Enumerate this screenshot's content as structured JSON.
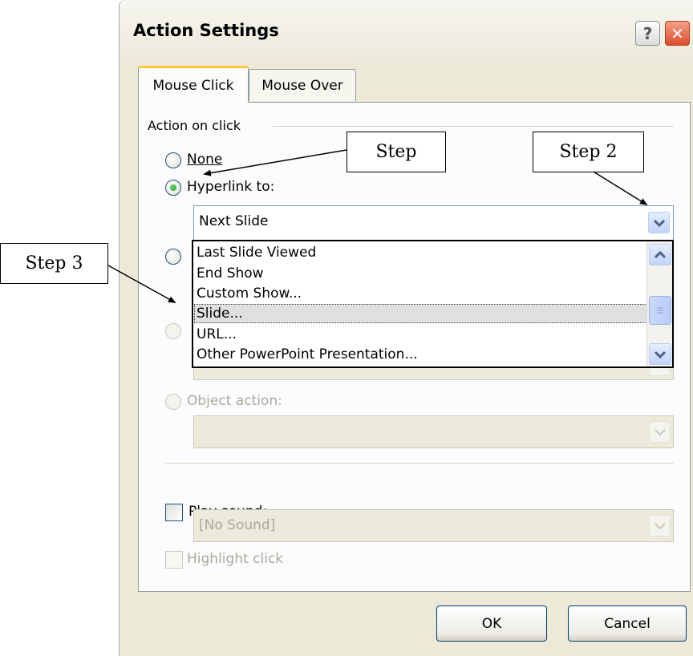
{
  "window": {
    "title": "Action Settings",
    "help_glyph": "?",
    "close_glyph": "✕"
  },
  "tabs": [
    {
      "label": "Mouse Click",
      "active": true
    },
    {
      "label": "Mouse Over",
      "active": false
    }
  ],
  "action_group": {
    "label": "Action on click",
    "none_label": "None",
    "hyperlink_label": "Hyperlink to:",
    "selected": "hyperlink",
    "hyperlink_value": "Next Slide",
    "object_action_label": "Object action:"
  },
  "dropdown": {
    "items": [
      "Last Slide Viewed",
      "End Show",
      "Custom Show...",
      "Slide...",
      "URL...",
      "Other PowerPoint Presentation..."
    ],
    "highlighted": "Slide..."
  },
  "sound": {
    "play_sound_label": "Play sound:",
    "sound_value": "[No Sound]",
    "highlight_click_label": "Highlight click"
  },
  "buttons": {
    "ok": "OK",
    "cancel": "Cancel"
  },
  "annotations": {
    "step1": "Step",
    "step2": "Step 2",
    "step3": "Step 3"
  },
  "colors": {
    "dialog_bg": "#ece9d8",
    "tab_accent": "#ffc73c",
    "radio_selected": "#21a121"
  }
}
